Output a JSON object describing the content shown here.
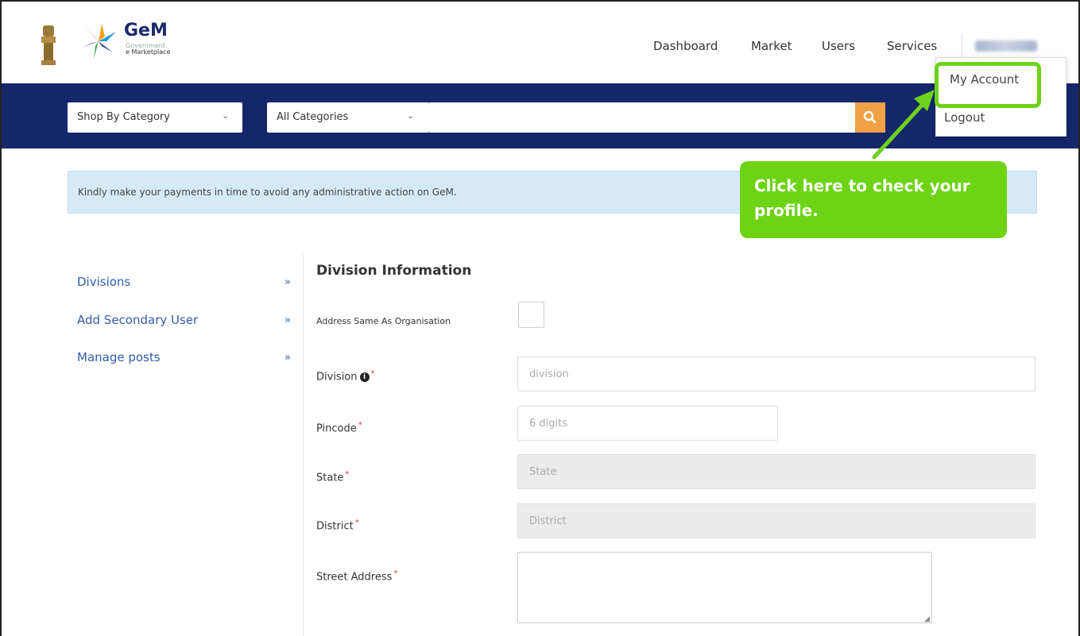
{
  "header": {
    "logo_text": "GeM",
    "logo_sub1": "Government",
    "logo_sub2": "e Marketplace",
    "nav": [
      {
        "label": "Dashboard"
      },
      {
        "label": "Market"
      },
      {
        "label": "Users"
      },
      {
        "label": "Services"
      }
    ]
  },
  "user_menu": {
    "items": [
      {
        "label": "My Account"
      },
      {
        "label": "Logout"
      }
    ]
  },
  "search_bar": {
    "shop_by_category": "Shop By Category",
    "all_categories": "All Categories",
    "search_placeholder": "",
    "search_icon": "search-icon"
  },
  "alert": {
    "text": "Kindly make your payments in time to avoid any administrative action on GeM."
  },
  "sidebar": {
    "items": [
      {
        "label": "Divisions",
        "arrow": "»"
      },
      {
        "label": "Add Secondary User",
        "arrow": "»"
      },
      {
        "label": "Manage posts",
        "arrow": "»"
      }
    ]
  },
  "form": {
    "title": "Division Information",
    "address_same_label": "Address Same As Organisation",
    "division_label": "Division",
    "division_placeholder": "division",
    "pincode_label": "Pincode",
    "pincode_placeholder": "6 digits",
    "state_label": "State",
    "state_placeholder": "State",
    "district_label": "District",
    "district_placeholder": "District",
    "street_label": "Street Address",
    "required_mark": "*",
    "info_glyph": "i"
  },
  "callout": {
    "text": "Click here to check your profile."
  },
  "colors": {
    "navy": "#15276b",
    "search_button": "#f0a045",
    "callout_green": "#6dd314",
    "link_blue": "#2f5ea8",
    "alert_bg": "#d6eaf6"
  }
}
